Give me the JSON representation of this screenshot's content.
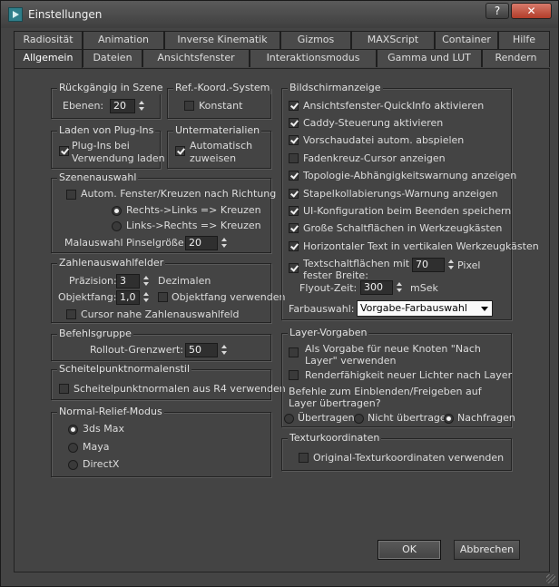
{
  "window": {
    "title": "Einstellungen",
    "help": "?",
    "close": "✕"
  },
  "tabs_back": [
    "Radiosität",
    "Animation",
    "Inverse Kinematik",
    "Gizmos",
    "MAXScript",
    "Container",
    "Hilfe"
  ],
  "tabs_front": [
    "Allgemein",
    "Dateien",
    "Ansichtsfenster",
    "Interaktionsmodus",
    "Gamma und LUT",
    "Rendern"
  ],
  "undo": {
    "title": "Rückgängig in Szene",
    "levels_label": "Ebenen:",
    "levels_value": "20"
  },
  "refcoord": {
    "title": "Ref.-Koord.-System",
    "constant_label": "Konstant",
    "constant_checked": false
  },
  "plugins": {
    "title": "Laden von Plug-Ins",
    "load_label_line1": "Plug-Ins bei",
    "load_label_line2": "Verwendung laden",
    "load_checked": true
  },
  "submaterials": {
    "title": "Untermaterialien",
    "auto_label_line1": "Automatisch",
    "auto_label_line2": "zuweisen",
    "auto_checked": true
  },
  "sceneselect": {
    "title": "Szenenauswahl",
    "auto_window_label": "Autom. Fenster/Kreuzen nach Richtung",
    "rtl_label": "Rechts->Links => Kreuzen",
    "ltr_label": "Links->Rechts => Kreuzen",
    "brush_label": "Malauswahl Pinselgröße",
    "brush_value": "20"
  },
  "spinners": {
    "title": "Zahlenauswahlfelder",
    "precision_label": "Präzision:",
    "precision_value": "3",
    "decimals_label": "Dezimalen",
    "snap_label": "Objektfang:",
    "snap_value": "1,0",
    "use_snap_label": "Objektfang verwenden",
    "cursor_label": "Cursor nahe Zahlenauswahlfeld"
  },
  "commandpanel": {
    "title": "Befehlsgruppe",
    "rollout_label": "Rollout-Grenzwert:",
    "rollout_value": "50"
  },
  "vertexnormal": {
    "title": "Scheitelpunktnormalenstil",
    "r4_label": "Scheitelpunktnormalen aus R4 verwenden"
  },
  "normalbump": {
    "title": "Normal-Relief-Modus",
    "options": [
      "3ds Max",
      "Maya",
      "DirectX"
    ],
    "selected": "3ds Max"
  },
  "display": {
    "title": "Bildschirmanzeige",
    "items": [
      {
        "label": "Ansichtsfenster-QuickInfo aktivieren",
        "checked": true
      },
      {
        "label": "Caddy-Steuerung aktivieren",
        "checked": true
      },
      {
        "label": "Vorschaudatei autom. abspielen",
        "checked": true
      },
      {
        "label": "Fadenkreuz-Cursor anzeigen",
        "checked": false
      },
      {
        "label": "Topologie-Abhängigkeitswarnung anzeigen",
        "checked": true
      },
      {
        "label": "Stapelkollabierungs-Warnung anzeigen",
        "checked": true
      },
      {
        "label": "UI-Konfiguration beim Beenden speichern",
        "checked": true
      },
      {
        "label": "Große Schaltflächen in Werkzeugkästen",
        "checked": true
      },
      {
        "label": "Horizontaler Text in vertikalen Werkzeugkästen",
        "checked": true
      }
    ],
    "fixed_width_line1": "Textschaltflächen mit",
    "fixed_width_line2": "fester Breite:",
    "fixed_width_checked": true,
    "fixed_width_value": "70",
    "pixel_label": "Pixel",
    "flyout_label": "Flyout-Zeit:",
    "flyout_value": "300",
    "msek_label": "mSek",
    "color_label": "Farbauswahl:",
    "color_value": "Vorgabe-Farbauswahl"
  },
  "layer": {
    "title": "Layer-Vorgaben",
    "default_line1": "Als Vorgabe für neue Knoten \"Nach",
    "default_line2": "Layer\" verwenden",
    "render_label": "Renderfähigkeit neuer Lichter nach Layer",
    "q_line1": "Befehle zum Einblenden/Freigeben auf",
    "q_line2": "Layer übertragen?",
    "radios": [
      "Übertragen",
      "Nicht übertragen",
      "Nachfragen"
    ],
    "selected": "Nachfragen"
  },
  "texcoord": {
    "title": "Texturkoordinaten",
    "label": "Original-Texturkoordinaten verwenden"
  },
  "buttons": {
    "ok": "OK",
    "cancel": "Abbrechen"
  }
}
